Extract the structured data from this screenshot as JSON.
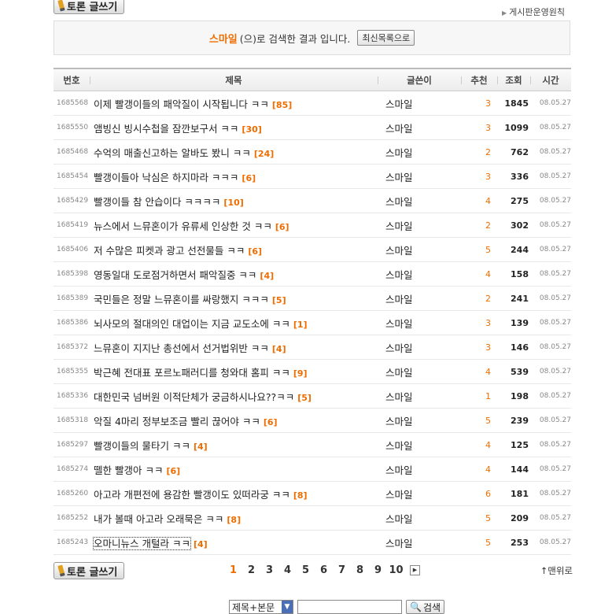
{
  "write_button": {
    "label": "토론 글쓰기"
  },
  "rules_link": "게시판운영원칙",
  "search_result": {
    "keyword": "스마일",
    "suffix": "(으)로 검색한 결과 입니다.",
    "latest_button": "최신목록으로"
  },
  "columns": [
    "번호",
    "제목",
    "글쓴이",
    "추천",
    "조회",
    "시간"
  ],
  "rows": [
    {
      "no": "1685568",
      "title": "이제 빨갱이들의 패악질이 시작됩니다 ㅋㅋ",
      "comments": "[85]",
      "writer": "스마일",
      "rec": "3",
      "views": "1845",
      "time": "08.05.27"
    },
    {
      "no": "1685550",
      "title": "앰빙신 빙시수첩을 잠깐보구서 ㅋㅋ",
      "comments": "[30]",
      "writer": "스마일",
      "rec": "3",
      "views": "1099",
      "time": "08.05.27"
    },
    {
      "no": "1685468",
      "title": "수억의 매출신고하는 알바도 봤니 ㅋㅋ",
      "comments": "[24]",
      "writer": "스마일",
      "rec": "2",
      "views": "762",
      "time": "08.05.27"
    },
    {
      "no": "1685454",
      "title": "빨갱이들아 낙심은 하지마라 ㅋㅋㅋ",
      "comments": "[6]",
      "writer": "스마일",
      "rec": "3",
      "views": "336",
      "time": "08.05.27"
    },
    {
      "no": "1685429",
      "title": "빨갱이들 참 안습이다 ㅋㅋㅋㅋ",
      "comments": "[10]",
      "writer": "스마일",
      "rec": "4",
      "views": "275",
      "time": "08.05.27"
    },
    {
      "no": "1685419",
      "title": "뉴스에서 느뮤혼이가 유류세 인상한 것 ㅋㅋ",
      "comments": "[6]",
      "writer": "스마일",
      "rec": "2",
      "views": "302",
      "time": "08.05.27"
    },
    {
      "no": "1685406",
      "title": "저 수많은 피켓과 광고 선전물들 ㅋㅋ",
      "comments": "[6]",
      "writer": "스마일",
      "rec": "5",
      "views": "244",
      "time": "08.05.27"
    },
    {
      "no": "1685398",
      "title": "영동일대 도로점거하면서 패악질중 ㅋㅋ",
      "comments": "[4]",
      "writer": "스마일",
      "rec": "4",
      "views": "158",
      "time": "08.05.27"
    },
    {
      "no": "1685389",
      "title": "국민들은 정말 느뮤혼이를 싸랑했지 ㅋㅋㅋ",
      "comments": "[5]",
      "writer": "스마일",
      "rec": "2",
      "views": "241",
      "time": "08.05.27"
    },
    {
      "no": "1685386",
      "title": "뇌사모의 절대의인 대업이는 지금 교도소에 ㅋㅋ",
      "comments": "[1]",
      "writer": "스마일",
      "rec": "3",
      "views": "139",
      "time": "08.05.27"
    },
    {
      "no": "1685372",
      "title": "느뮤혼이 지지난 총선에서 선거법위반 ㅋㅋ",
      "comments": "[4]",
      "writer": "스마일",
      "rec": "3",
      "views": "146",
      "time": "08.05.27"
    },
    {
      "no": "1685355",
      "title": "박근혜 전대표 포르노패러디를 청와대 홈피 ㅋㅋ",
      "comments": "[9]",
      "writer": "스마일",
      "rec": "4",
      "views": "539",
      "time": "08.05.27"
    },
    {
      "no": "1685336",
      "title": "대한민국 넘버원 이적단체가 궁금하시나요??ㅋㅋ",
      "comments": "[5]",
      "writer": "스마일",
      "rec": "1",
      "views": "198",
      "time": "08.05.27"
    },
    {
      "no": "1685318",
      "title": "악질 4마리 정부보조금 빨리 끊어야 ㅋㅋ",
      "comments": "[6]",
      "writer": "스마일",
      "rec": "5",
      "views": "239",
      "time": "08.05.27"
    },
    {
      "no": "1685297",
      "title": "빨갱이들의 물타기 ㅋㅋ",
      "comments": "[4]",
      "writer": "스마일",
      "rec": "4",
      "views": "125",
      "time": "08.05.27"
    },
    {
      "no": "1685274",
      "title": "뗄한 빨갱아 ㅋㅋ",
      "comments": "[6]",
      "writer": "스마일",
      "rec": "4",
      "views": "144",
      "time": "08.05.27"
    },
    {
      "no": "1685260",
      "title": "아고라 개편전에 용감한 빨갱이도 있떠라궁 ㅋㅋ",
      "comments": "[8]",
      "writer": "스마일",
      "rec": "6",
      "views": "181",
      "time": "08.05.27"
    },
    {
      "no": "1685252",
      "title": "내가 볼때 아고라 오래묵은 ㅋㅋ",
      "comments": "[8]",
      "writer": "스마일",
      "rec": "5",
      "views": "209",
      "time": "08.05.27"
    },
    {
      "no": "1685243",
      "title": "오마니뉴스 개털라 ㅋㅋ",
      "comments": "[4]",
      "writer": "스마일",
      "rec": "5",
      "views": "253",
      "time": "08.05.27"
    }
  ],
  "pagination": {
    "pages": [
      "1",
      "2",
      "3",
      "4",
      "5",
      "6",
      "7",
      "8",
      "9",
      "10"
    ],
    "current": "1"
  },
  "to_top": "맨위로",
  "bottom_search": {
    "select_value": "제목+본문",
    "button": "검색"
  },
  "colors": {
    "accent": "#ef6d00"
  }
}
